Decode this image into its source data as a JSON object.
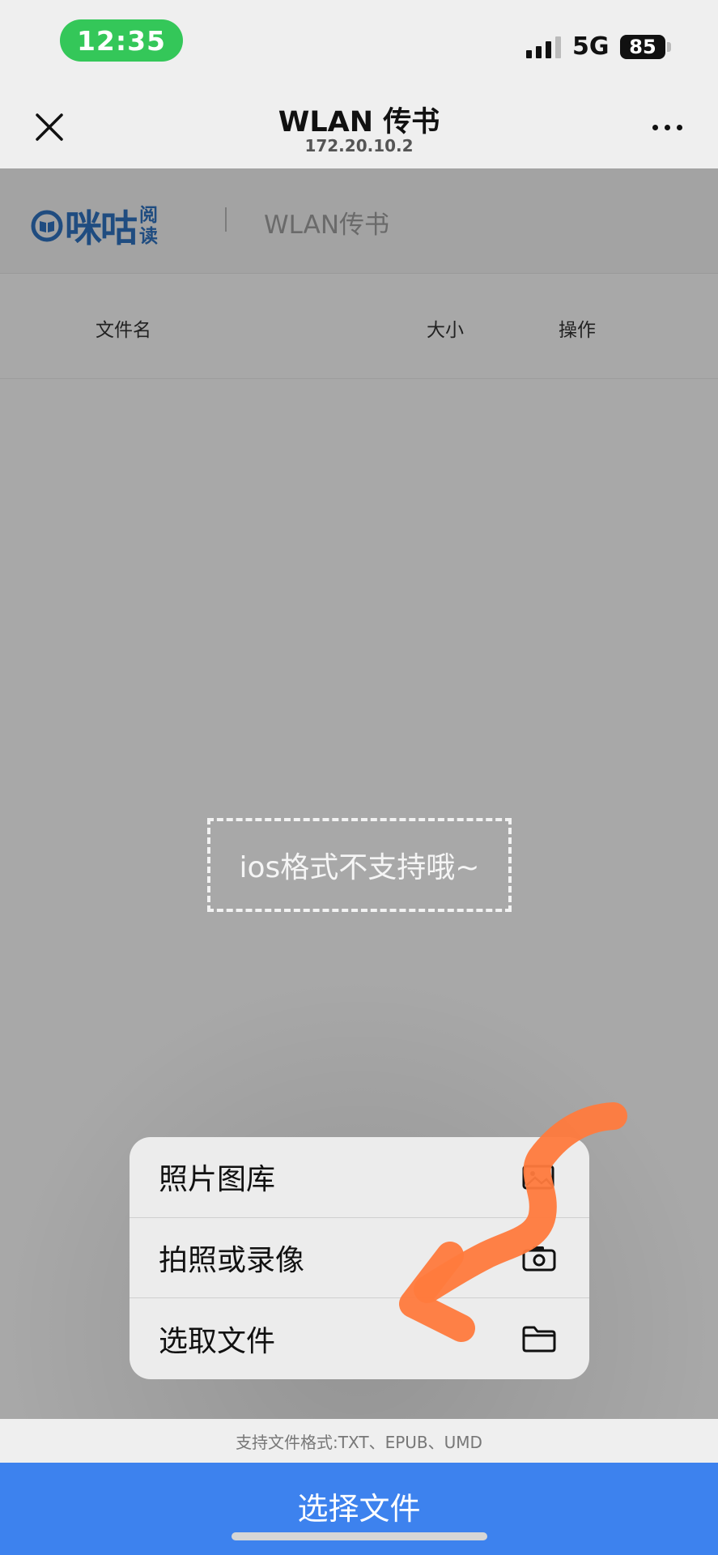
{
  "status_bar": {
    "time": "12:35",
    "network": "5G",
    "battery": "85"
  },
  "nav": {
    "title": "WLAN 传书",
    "subtitle": "172.20.10.2"
  },
  "header": {
    "logo_main": "咪咕",
    "logo_small_1": "阅",
    "logo_small_2": "读",
    "title": "WLAN传书"
  },
  "table": {
    "columns": [
      "文件名",
      "大小",
      "操作"
    ]
  },
  "empty_hint": "ios格式不支持哦~",
  "menu": {
    "items": [
      {
        "label": "照片图库",
        "icon": "photo-library-icon"
      },
      {
        "label": "拍照或录像",
        "icon": "camera-icon"
      },
      {
        "label": "选取文件",
        "icon": "folder-icon"
      }
    ]
  },
  "footer": {
    "formats": "支持文件格式:TXT、EPUB、UMD",
    "select_button": "选择文件"
  },
  "colors": {
    "accent_blue": "#3d82ee",
    "time_pill_green": "#34c759",
    "logo_blue": "#1f4c80",
    "marker_orange": "#ff7a3d"
  }
}
